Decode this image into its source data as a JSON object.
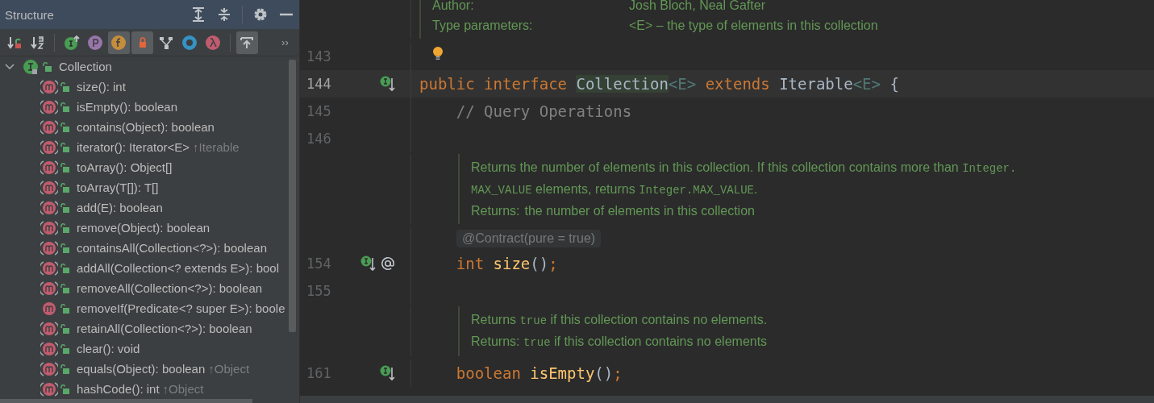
{
  "structure_panel": {
    "title": "Structure",
    "header_buttons": [
      {
        "kind": "expand-all"
      },
      {
        "kind": "collapse-all"
      },
      {
        "kind": "settings"
      },
      {
        "kind": "hide"
      }
    ],
    "toolbar": [
      {
        "kind": "sort-visibility",
        "selected": false
      },
      {
        "kind": "sort-alpha",
        "selected": false
      },
      {
        "kind": "inherited",
        "selected": false
      },
      {
        "kind": "properties",
        "selected": false
      },
      {
        "kind": "fields",
        "selected": true
      },
      {
        "kind": "non-public",
        "selected": true
      },
      {
        "kind": "hierarchy",
        "selected": false
      },
      {
        "kind": "anonymous",
        "selected": false
      },
      {
        "kind": "lambdas",
        "selected": false
      },
      {
        "kind": "autoscroll",
        "selected": true
      },
      {
        "kind": "more",
        "text": "››",
        "selected": false
      }
    ],
    "tree": [
      {
        "label": "Collection",
        "kind": "interface",
        "expanded": true,
        "children": [
          {
            "label": "size(): int",
            "kind": "abstract"
          },
          {
            "label": "isEmpty(): boolean",
            "kind": "abstract"
          },
          {
            "label": "contains(Object): boolean",
            "kind": "abstract"
          },
          {
            "label": "iterator(): Iterator<E>",
            "kind": "abstract",
            "inherited": "↑Iterable"
          },
          {
            "label": "toArray(): Object[]",
            "kind": "abstract"
          },
          {
            "label": "toArray(T[]): T[]",
            "kind": "abstract"
          },
          {
            "label": "add(E): boolean",
            "kind": "abstract"
          },
          {
            "label": "remove(Object): boolean",
            "kind": "abstract"
          },
          {
            "label": "containsAll(Collection<?>): boolean",
            "kind": "abstract"
          },
          {
            "label": "addAll(Collection<? extends E>): bool",
            "kind": "abstract"
          },
          {
            "label": "removeAll(Collection<?>): boolean",
            "kind": "abstract"
          },
          {
            "label": "removeIf(Predicate<? super E>): boole",
            "kind": "method"
          },
          {
            "label": "retainAll(Collection<?>): boolean",
            "kind": "abstract"
          },
          {
            "label": "clear(): void",
            "kind": "abstract"
          },
          {
            "label": "equals(Object): boolean",
            "kind": "abstract",
            "inherited": "↑Object"
          },
          {
            "label": "hashCode(): int",
            "kind": "abstract",
            "inherited": "↑Object"
          }
        ]
      }
    ]
  },
  "editor": {
    "rows": [
      {
        "kind": "doc",
        "lines": [
          {
            "kind": "pair",
            "key": "Author:",
            "value": "Josh Bloch, Neal Gafter"
          },
          {
            "kind": "pair",
            "key": "Type parameters:",
            "value": "<E> – the type of elements in this collection"
          }
        ]
      },
      {
        "kind": "code",
        "number": "143",
        "markers": [
          {
            "kind": "lightbulb"
          }
        ],
        "tokens": []
      },
      {
        "kind": "code",
        "number": "144",
        "gutter": [
          {
            "kind": "implemented"
          }
        ],
        "tokens": [
          {
            "kind": "keyword",
            "s": "public interface "
          },
          {
            "kind": "highlight",
            "s": "Collection"
          },
          {
            "kind": "tparam",
            "s": "<E>"
          },
          {
            "kind": "keyword",
            "s": " extends "
          },
          {
            "kind": "plain",
            "s": "Iterable"
          },
          {
            "kind": "tparam",
            "s": "<E>"
          },
          {
            "kind": "plain",
            "s": " {"
          }
        ]
      },
      {
        "kind": "code",
        "number": "145",
        "tokens": [
          {
            "kind": "comment",
            "s": "    // Query Operations"
          }
        ]
      },
      {
        "kind": "code",
        "number": "146",
        "tokens": []
      },
      {
        "kind": "doc-nested",
        "lines": [
          {
            "kind": "text",
            "parts": [
              {
                "kind": "prose",
                "s": "Returns the number of elements in this collection. If this collection contains more than "
              },
              {
                "kind": "code",
                "s": "Integer."
              }
            ]
          },
          {
            "kind": "text",
            "parts": [
              {
                "kind": "code",
                "s": "MAX_VALUE"
              },
              {
                "kind": "prose",
                "s": " elements, returns "
              },
              {
                "kind": "code",
                "s": "Integer.MAX_VALUE"
              },
              {
                "kind": "prose",
                "s": "."
              }
            ]
          },
          {
            "kind": "pair-inline",
            "key": "Returns:",
            "value": "the number of elements in this collection"
          }
        ]
      },
      {
        "kind": "annotation",
        "text": "@Contract(pure = true)"
      },
      {
        "kind": "code",
        "number": "154",
        "gutter": [
          {
            "kind": "implemented"
          },
          {
            "kind": "annotated"
          }
        ],
        "tokens": [
          {
            "kind": "keyword",
            "s": "    int "
          },
          {
            "kind": "method",
            "s": "size"
          },
          {
            "kind": "plain",
            "s": "()"
          },
          {
            "kind": "keyword",
            "s": ";"
          }
        ]
      },
      {
        "kind": "code",
        "number": "155",
        "tokens": []
      },
      {
        "kind": "doc-nested",
        "lines": [
          {
            "kind": "text",
            "parts": [
              {
                "kind": "prose",
                "s": "Returns "
              },
              {
                "kind": "code",
                "s": "true"
              },
              {
                "kind": "prose",
                "s": " if this collection contains no elements."
              }
            ]
          },
          {
            "kind": "text",
            "parts": [
              {
                "kind": "prose",
                "s": "Returns: "
              },
              {
                "kind": "code",
                "s": "true"
              },
              {
                "kind": "prose",
                "s": " if this collection contains no elements"
              }
            ]
          }
        ]
      },
      {
        "kind": "code",
        "number": "161",
        "gutter": [
          {
            "kind": "implemented"
          }
        ],
        "tokens": [
          {
            "kind": "keyword",
            "s": "    boolean "
          },
          {
            "kind": "method",
            "s": "isEmpty"
          },
          {
            "kind": "plain",
            "s": "()"
          },
          {
            "kind": "keyword",
            "s": ";"
          }
        ]
      }
    ]
  }
}
